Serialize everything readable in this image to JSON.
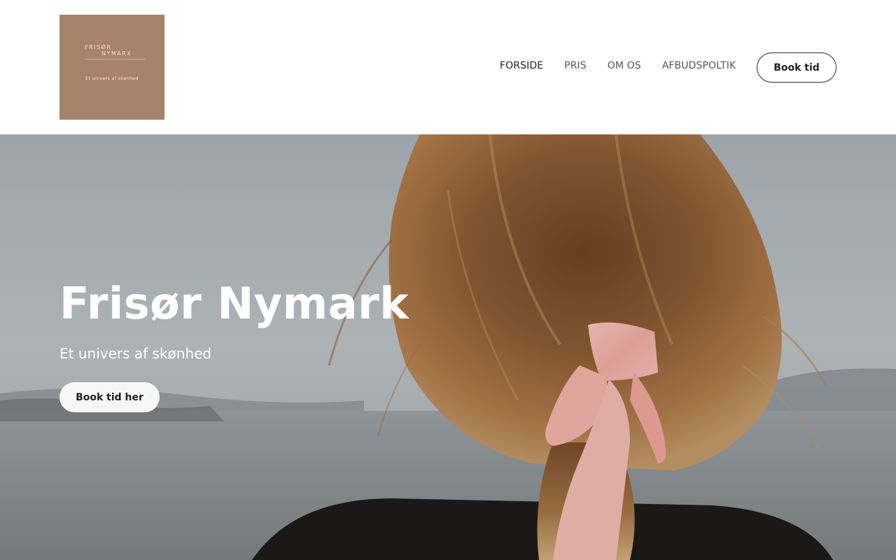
{
  "logo": {
    "line1": "FRISØR",
    "line2": "NYMARX",
    "tagline": "Et univers af skønhed"
  },
  "nav": {
    "items": [
      {
        "label": "FORSIDE",
        "active": true
      },
      {
        "label": "PRIS",
        "active": false
      },
      {
        "label": "OM OS",
        "active": false
      },
      {
        "label": "AFBUDSPOLTIK",
        "active": false
      }
    ],
    "book_label": "Book tid"
  },
  "hero": {
    "title": "Frisør Nymark",
    "subtitle": "Et univers af skønhed",
    "cta_label": "Book tid her"
  },
  "colors": {
    "logo_bg": "#a6836a",
    "ribbon": "#f2b7ae",
    "hair": "#8a5a32"
  }
}
